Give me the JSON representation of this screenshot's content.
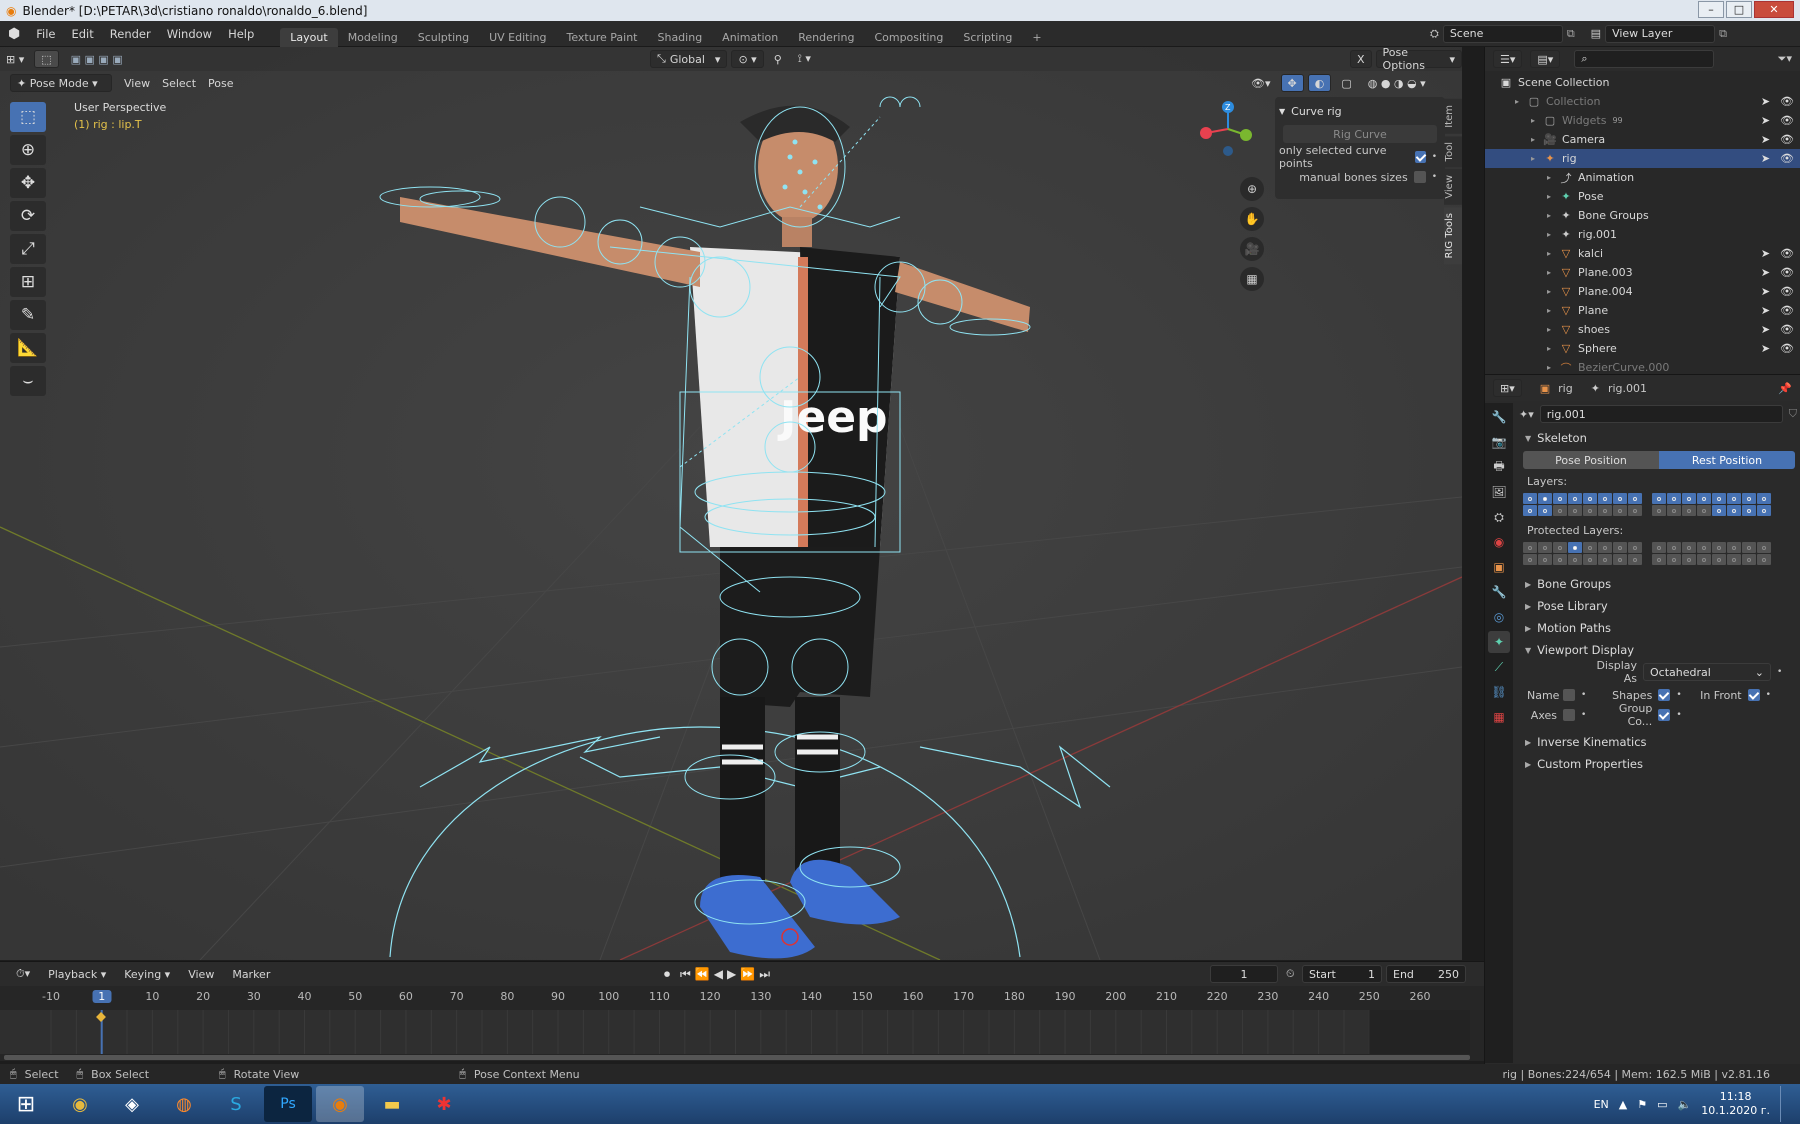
{
  "window": {
    "title": "Blender* [D:\\PETAR\\3d\\cristiano ronaldo\\ronaldo_6.blend]"
  },
  "menu": {
    "items": [
      "File",
      "Edit",
      "Render",
      "Window",
      "Help"
    ]
  },
  "workspaces": {
    "tabs": [
      "Layout",
      "Modeling",
      "Sculpting",
      "UV Editing",
      "Texture Paint",
      "Shading",
      "Animation",
      "Rendering",
      "Compositing",
      "Scripting"
    ],
    "add": "+"
  },
  "scene": {
    "label": "Scene",
    "view_layer": "View Layer"
  },
  "viewport": {
    "mode": "Pose Mode",
    "header_menu": [
      "View",
      "Select",
      "Pose"
    ],
    "orientation": "Global",
    "pose_options": "Pose Options",
    "x_mirror": "X",
    "info_line1": "User Perspective",
    "info_line2": "(1) rig : lip.T",
    "side_tabs": [
      "Item",
      "Tool",
      "View",
      "RIG Tools"
    ],
    "axis": {
      "x": "X",
      "y": "Y",
      "z": "Z"
    }
  },
  "curve_rig": {
    "title": "Curve rig",
    "button": "Rig Curve",
    "opt1": "only selected curve points",
    "opt2": "manual bones sizes"
  },
  "timeline": {
    "menus": [
      "Playback",
      "Keying",
      "View",
      "Marker"
    ],
    "current_frame": "1",
    "start_label": "Start",
    "start": "1",
    "end_label": "End",
    "end": "250",
    "ticks": [
      "-10",
      "1",
      "10",
      "20",
      "30",
      "40",
      "50",
      "60",
      "70",
      "80",
      "90",
      "100",
      "110",
      "120",
      "130",
      "140",
      "150",
      "160",
      "170",
      "180",
      "190",
      "200",
      "210",
      "220",
      "230",
      "240",
      "250",
      "260"
    ]
  },
  "outliner": {
    "root": "Scene Collection",
    "items": [
      {
        "label": "Collection",
        "indent": 1,
        "dim": true
      },
      {
        "label": "Widgets",
        "indent": 2,
        "dim": true,
        "badge": "99"
      },
      {
        "label": "Camera",
        "indent": 2
      },
      {
        "label": "rig",
        "indent": 2,
        "selected": true
      },
      {
        "label": "Animation",
        "indent": 3
      },
      {
        "label": "Pose",
        "indent": 3
      },
      {
        "label": "Bone Groups",
        "indent": 3
      },
      {
        "label": "rig.001",
        "indent": 3
      },
      {
        "label": "kalci",
        "indent": 3
      },
      {
        "label": "Plane.003",
        "indent": 3
      },
      {
        "label": "Plane.004",
        "indent": 3
      },
      {
        "label": "Plane",
        "indent": 3
      },
      {
        "label": "shoes",
        "indent": 3
      },
      {
        "label": "Sphere",
        "indent": 3
      },
      {
        "label": "BezierCurve.000",
        "indent": 3,
        "dim": true
      }
    ]
  },
  "properties": {
    "breadcrumb_obj": "rig",
    "breadcrumb_data": "rig.001",
    "datablock": "rig.001",
    "skeleton": "Skeleton",
    "pose_position": "Pose Position",
    "rest_position": "Rest Position",
    "layers_label": "Layers:",
    "protected_label": "Protected Layers:",
    "sections": [
      "Bone Groups",
      "Pose Library",
      "Motion Paths"
    ],
    "viewport_display": "Viewport Display",
    "display_as_label": "Display As",
    "display_as": "Octahedral",
    "name": "Name",
    "shapes": "Shapes",
    "in_front": "In Front",
    "axes": "Axes",
    "group_colors": "Group Co...",
    "sections2": [
      "Inverse Kinematics",
      "Custom Properties"
    ]
  },
  "statusbar": {
    "select": "Select",
    "box_select": "Box Select",
    "rotate": "Rotate View",
    "context": "Pose Context Menu",
    "info": "rig | Bones:224/654 | Mem: 162.5 MiB | v2.81.16"
  },
  "taskbar": {
    "lang": "EN",
    "time": "11:18",
    "date": "10.1.2020 г."
  },
  "colors": {
    "accent": "#4772b3",
    "rig_wire": "#8fe3f2",
    "header": "#2b2b2b"
  }
}
